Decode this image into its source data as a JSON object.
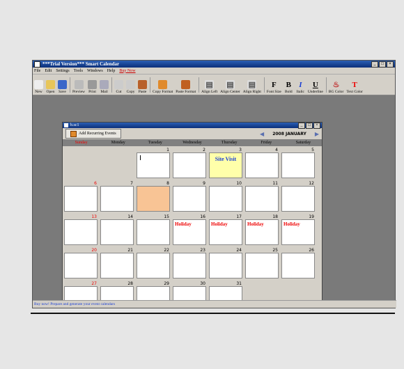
{
  "app": {
    "title": "***Trial Version*** Smart Calendar",
    "menu": [
      "File",
      "Edit",
      "Settings",
      "Tools",
      "Windows",
      "Help"
    ],
    "menu_buy": "Buy Now",
    "toolbar": [
      {
        "label": "New",
        "icon": "new-doc-icon",
        "color": "#eee",
        "glyph": ""
      },
      {
        "label": "Open",
        "icon": "open-folder-icon",
        "color": "#e8c65a",
        "glyph": ""
      },
      {
        "label": "Save",
        "icon": "save-disk-icon",
        "color": "#3b67c9",
        "glyph": ""
      },
      {
        "label": "Preview",
        "icon": "preview-icon",
        "color": "#bbb",
        "glyph": ""
      },
      {
        "label": "Print",
        "icon": "print-icon",
        "color": "#999",
        "glyph": ""
      },
      {
        "label": "Mail",
        "icon": "mail-icon",
        "color": "#aab",
        "glyph": ""
      },
      {
        "label": "Cut",
        "icon": "cut-icon",
        "color": "#ccc",
        "glyph": ""
      },
      {
        "label": "Copy",
        "icon": "copy-icon",
        "color": "#ccc",
        "glyph": ""
      },
      {
        "label": "Paste",
        "icon": "paste-icon",
        "color": "#b8602b",
        "glyph": ""
      },
      {
        "label": "Copy Format",
        "icon": "copy-format-icon",
        "color": "#e08a2c",
        "glyph": ""
      },
      {
        "label": "Paste Format",
        "icon": "paste-format-icon",
        "color": "#c06020",
        "glyph": ""
      },
      {
        "label": "Align Left",
        "icon": "align-left-icon",
        "color": "#ddd",
        "glyph": "▤"
      },
      {
        "label": "Align Center",
        "icon": "align-center-icon",
        "color": "#ddd",
        "glyph": "▤"
      },
      {
        "label": "Align Right",
        "icon": "align-right-icon",
        "color": "#ddd",
        "glyph": "▤"
      },
      {
        "label": "Font Size",
        "icon": "font-size-icon",
        "color": "transparent",
        "glyph": "F"
      },
      {
        "label": "Bold",
        "icon": "bold-icon",
        "color": "transparent",
        "glyph": "B"
      },
      {
        "label": "Italic",
        "icon": "italic-icon",
        "color": "transparent",
        "glyph": "I"
      },
      {
        "label": "Underline",
        "icon": "underline-icon",
        "color": "transparent",
        "glyph": "U"
      },
      {
        "label": "BG Color",
        "icon": "bg-color-icon",
        "color": "transparent",
        "glyph": "♨"
      },
      {
        "label": "Text Color",
        "icon": "text-color-icon",
        "color": "transparent",
        "glyph": "T"
      }
    ],
    "status": "Buy now! Prepare and generate your event calendars"
  },
  "calendar": {
    "window_title": "b.sc1",
    "add_button": "Add Recurring Events",
    "month_label": "2008 JANUARY",
    "weekdays": [
      "Sunday",
      "Monday",
      "Tuesday",
      "Wednesday",
      "Thursday",
      "Friday",
      "Saturday"
    ],
    "days": [
      {
        "n": "",
        "blank": true
      },
      {
        "n": "",
        "blank": true
      },
      {
        "n": "1"
      },
      {
        "n": "2"
      },
      {
        "n": "3",
        "event": "Site Visit",
        "style": "highlight"
      },
      {
        "n": "4"
      },
      {
        "n": "5"
      },
      {
        "n": "6",
        "sun": true
      },
      {
        "n": "7"
      },
      {
        "n": "8",
        "style": "peach"
      },
      {
        "n": "9"
      },
      {
        "n": "10"
      },
      {
        "n": "11"
      },
      {
        "n": "12"
      },
      {
        "n": "13",
        "sun": true
      },
      {
        "n": "14"
      },
      {
        "n": "15"
      },
      {
        "n": "16",
        "holiday": "Holiday"
      },
      {
        "n": "17",
        "holiday": "Holiday"
      },
      {
        "n": "18",
        "holiday": "Holiday"
      },
      {
        "n": "19",
        "holiday": "Holiday"
      },
      {
        "n": "20",
        "sun": true
      },
      {
        "n": "21"
      },
      {
        "n": "22"
      },
      {
        "n": "23"
      },
      {
        "n": "24"
      },
      {
        "n": "25"
      },
      {
        "n": "26"
      },
      {
        "n": "27",
        "sun": true
      },
      {
        "n": "28"
      },
      {
        "n": "29"
      },
      {
        "n": "30"
      },
      {
        "n": "31"
      }
    ]
  }
}
